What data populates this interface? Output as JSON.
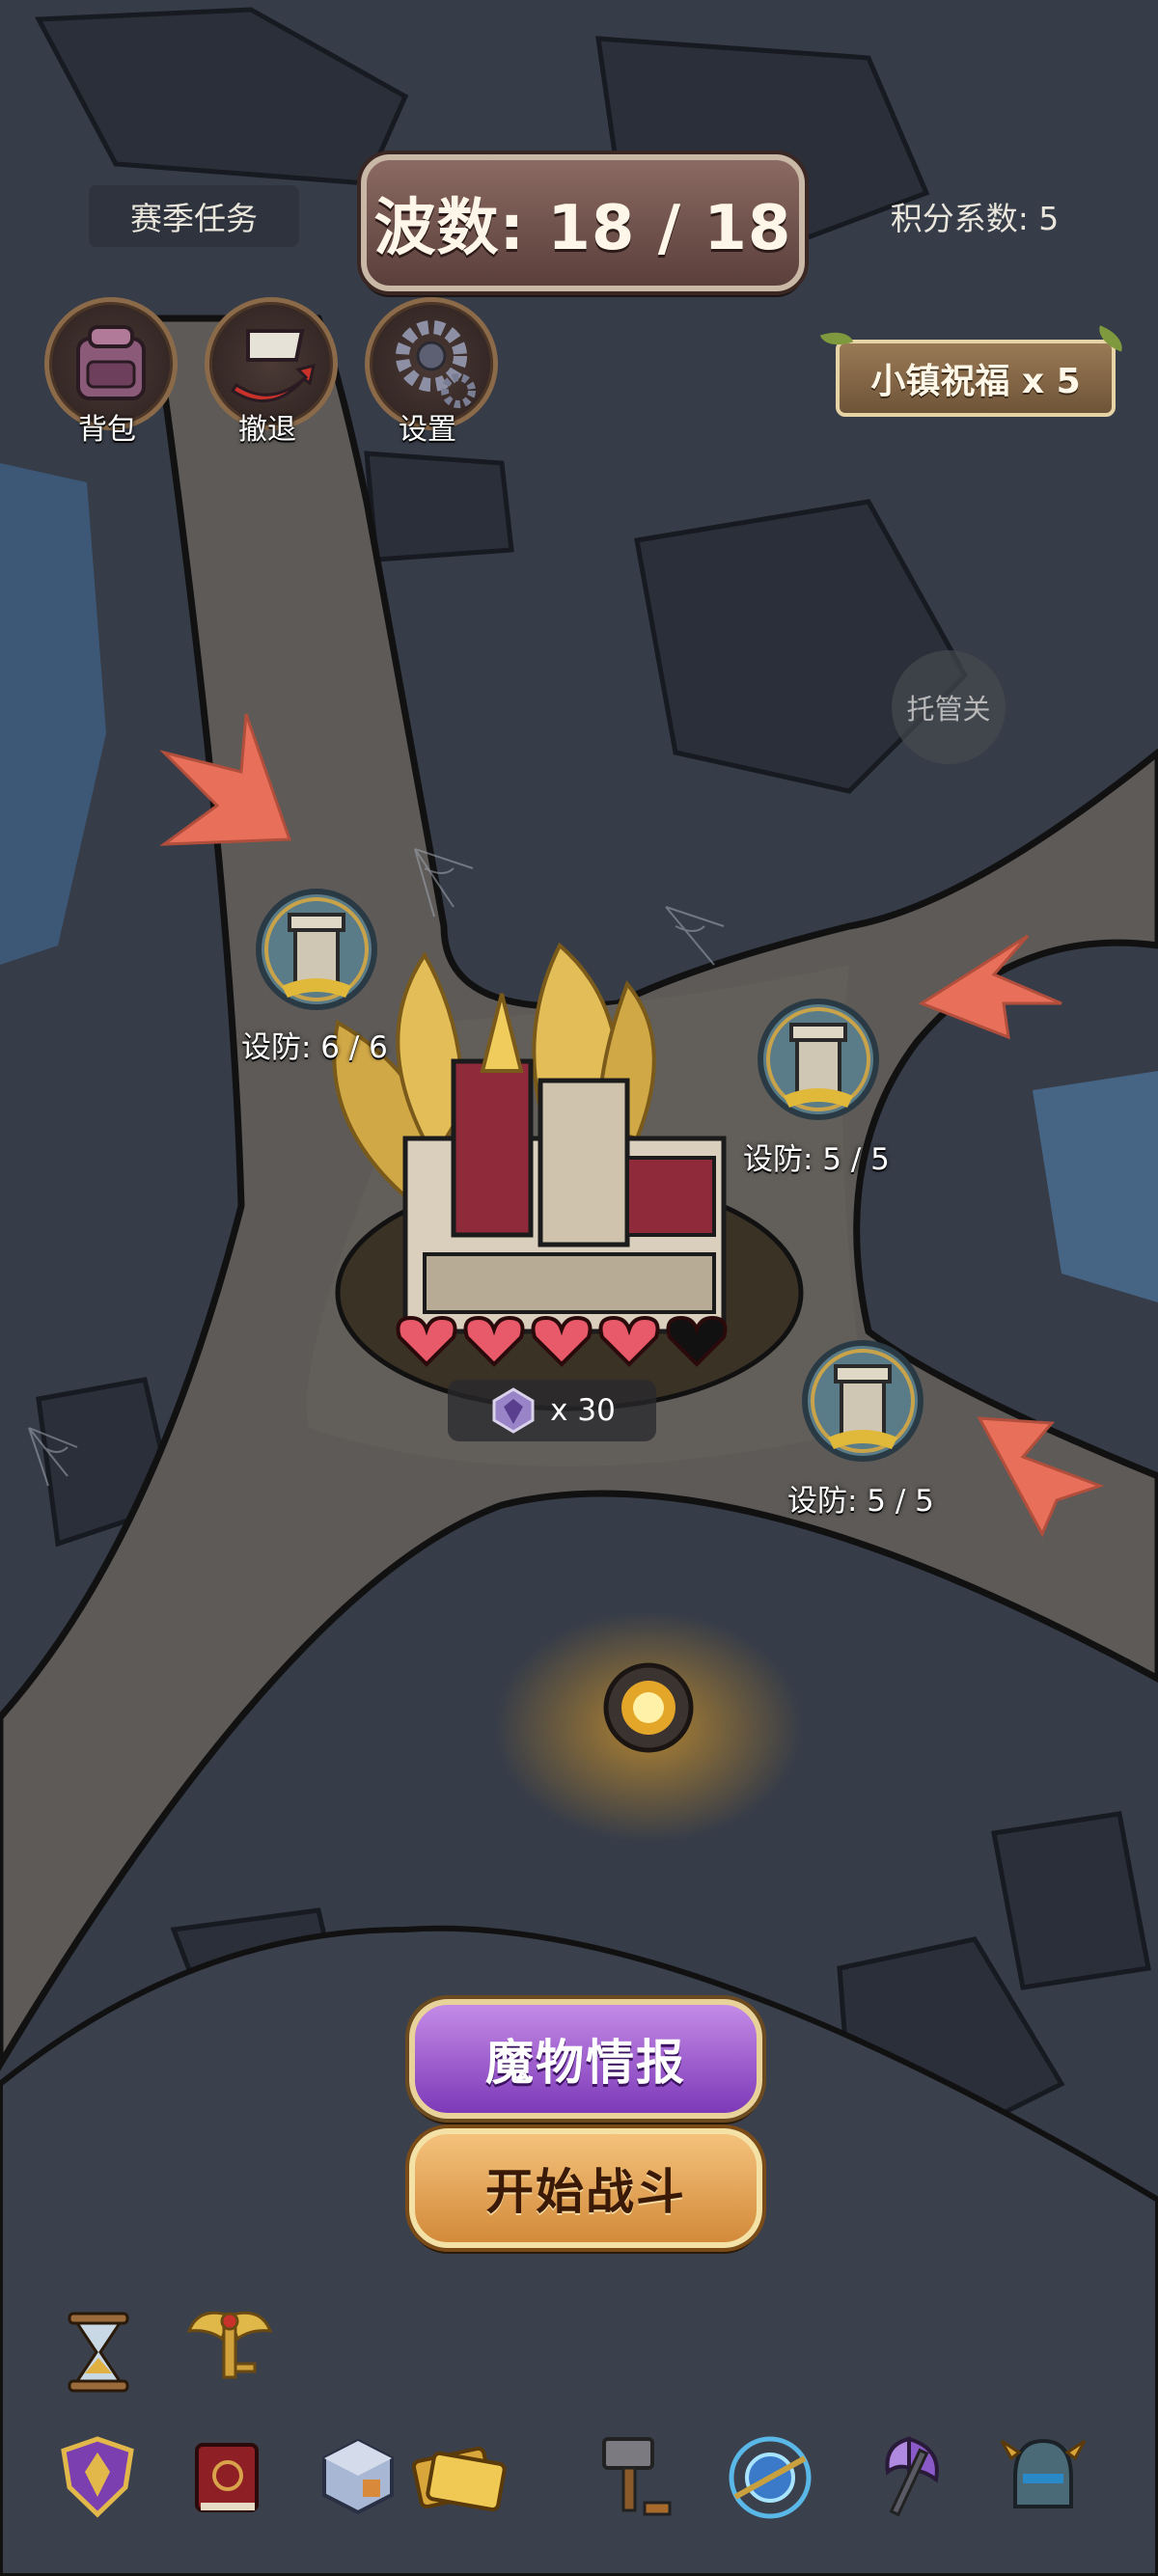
{
  "hud": {
    "season_tasks": "赛季任务",
    "wave_label": "波数: 18 / 18",
    "score_coefficient": "积分系数: 5",
    "town_blessing": "小镇祝福 x 5"
  },
  "top_buttons": [
    {
      "label": "背包",
      "icon": "backpack-icon"
    },
    {
      "label": "撤退",
      "icon": "retreat-flag-icon"
    },
    {
      "label": "设置",
      "icon": "gear-icon"
    }
  ],
  "auto_button": "托管关",
  "towers": [
    {
      "label": "设防: 6 / 6"
    },
    {
      "label": "设防: 5 / 5"
    },
    {
      "label": "设防: 5 / 5"
    }
  ],
  "castle": {
    "hearts_full": 4,
    "hearts_total": 5,
    "gem_count": "x 30"
  },
  "actions": {
    "monster_info": "魔物情报",
    "start_battle": "开始战斗"
  },
  "side_icons": [
    "hourglass-icon",
    "winged-key-icon"
  ],
  "bottom_bar": [
    "purple-shield-icon",
    "red-book-icon",
    "dice-cube-icon",
    "golden-tickets-icon",
    "hammer-icon",
    "magic-orb-icon",
    "battle-axe-icon",
    "knight-helmet-icon"
  ],
  "colors": {
    "arrow": "#e8705a",
    "heart": "#e85a6a",
    "map_path": "#5d5a57",
    "map_rock": "#3b4250"
  }
}
